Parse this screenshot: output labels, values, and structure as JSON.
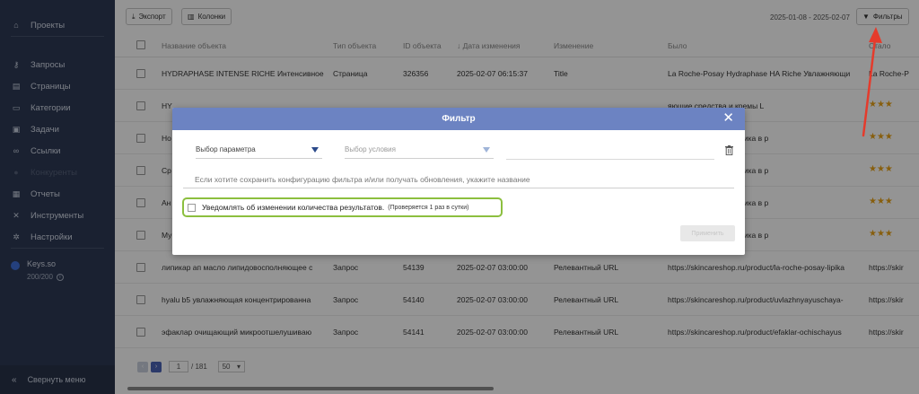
{
  "sidebar": {
    "items": [
      {
        "label": "Проекты",
        "icon": "home-icon",
        "glyph": "⌂",
        "dim": false
      },
      {
        "label": "Запросы",
        "icon": "key-icon",
        "glyph": "⚷",
        "dim": false
      },
      {
        "label": "Страницы",
        "icon": "page-icon",
        "glyph": "▤",
        "dim": false
      },
      {
        "label": "Категории",
        "icon": "folder-icon",
        "glyph": "▭",
        "dim": false
      },
      {
        "label": "Задачи",
        "icon": "task-icon",
        "glyph": "▣",
        "dim": false
      },
      {
        "label": "Ссылки",
        "icon": "link-icon",
        "glyph": "∞",
        "dim": false
      },
      {
        "label": "Конкуренты",
        "icon": "competitors-icon",
        "glyph": "●",
        "dim": true
      },
      {
        "label": "Отчеты",
        "icon": "report-icon",
        "glyph": "▦",
        "dim": false
      },
      {
        "label": "Инструменты",
        "icon": "tools-icon",
        "glyph": "✕",
        "dim": false
      },
      {
        "label": "Настройки",
        "icon": "gear-icon",
        "glyph": "✲",
        "dim": false
      }
    ],
    "keys_title": "Keys.so",
    "keys_count": "200/200",
    "collapse_label": "Свернуть меню"
  },
  "toolbar": {
    "export_label": "Экспорт",
    "columns_label": "Колонки",
    "date_range": "2025-01-08 - 2025-02-07",
    "filters_label": "Фильтры"
  },
  "table": {
    "columns": [
      "Название объекта",
      "Тип объекта",
      "ID объекта",
      "Дата изменения",
      "Изменение",
      "Было",
      "Стало"
    ],
    "rows": [
      {
        "name": "HYDRAPHASE INTENSE RICHE Интенсивное",
        "type": "Страница",
        "id": "326356",
        "date": "2025-02-07 06:15:37",
        "change": "Title",
        "was": "La Roche-Posay Hydraphase HA Riche Увлажняющи",
        "became": "La Roche-P"
      },
      {
        "name": "HY",
        "type": "",
        "id": "",
        "date": "",
        "change": "",
        "was": "яющие средства и кремы L",
        "became": "★★★"
      },
      {
        "name": "Но",
        "type": "",
        "id": "",
        "date": "",
        "change": "",
        "was": "ессиональная косметика в р",
        "became": "★★★"
      },
      {
        "name": "Ср",
        "type": "",
        "id": "",
        "date": "",
        "change": "",
        "was": "ессиональная косметика в р",
        "became": "★★★"
      },
      {
        "name": "Ан",
        "type": "",
        "id": "",
        "date": "",
        "change": "",
        "was": "ессиональная косметика в р",
        "became": "★★★"
      },
      {
        "name": "Му",
        "type": "",
        "id": "",
        "date": "",
        "change": "",
        "was": "ессиональная косметика в р",
        "became": "★★★"
      },
      {
        "name": "липикар ап масло липидовосполняющее с",
        "type": "Запрос",
        "id": "54139",
        "date": "2025-02-07 03:00:00",
        "change": "Релевантный URL",
        "was": "https://skincareshop.ru/product/la-roche-posay-lipika",
        "became": "https://skir"
      },
      {
        "name": "hyalu b5 увлажняющая концентрированна",
        "type": "Запрос",
        "id": "54140",
        "date": "2025-02-07 03:00:00",
        "change": "Релевантный URL",
        "was": "https://skincareshop.ru/product/uvlazhnyayuschaya-",
        "became": "https://skir"
      },
      {
        "name": "эфаклар очищающий микроотшелушиваю",
        "type": "Запрос",
        "id": "54141",
        "date": "2025-02-07 03:00:00",
        "change": "Релевантный URL",
        "was": "https://skincareshop.ru/product/efaklar-ochischayus",
        "became": "https://skir"
      }
    ]
  },
  "pager": {
    "page": "1",
    "total": "/ 181",
    "size": "50"
  },
  "modal": {
    "title": "Фильтр",
    "param_placeholder": "Выбор параметра",
    "condition_placeholder": "Выбор условия",
    "name_placeholder": "Если хотите сохранить конфигурацию фильтра и/или получать обновления, укажите название",
    "notify_label": "Уведомлять об изменении количества результатов.",
    "notify_hint": "(Проверяется 1 раз в сутки)",
    "apply_label": "Применить"
  },
  "colors": {
    "sidebar_bg": "#2e3a55",
    "modal_header": "#6c83c2",
    "highlight_box": "#8cbf3f",
    "annotation_arrow": "#e53b2c",
    "star": "#e8a317"
  }
}
